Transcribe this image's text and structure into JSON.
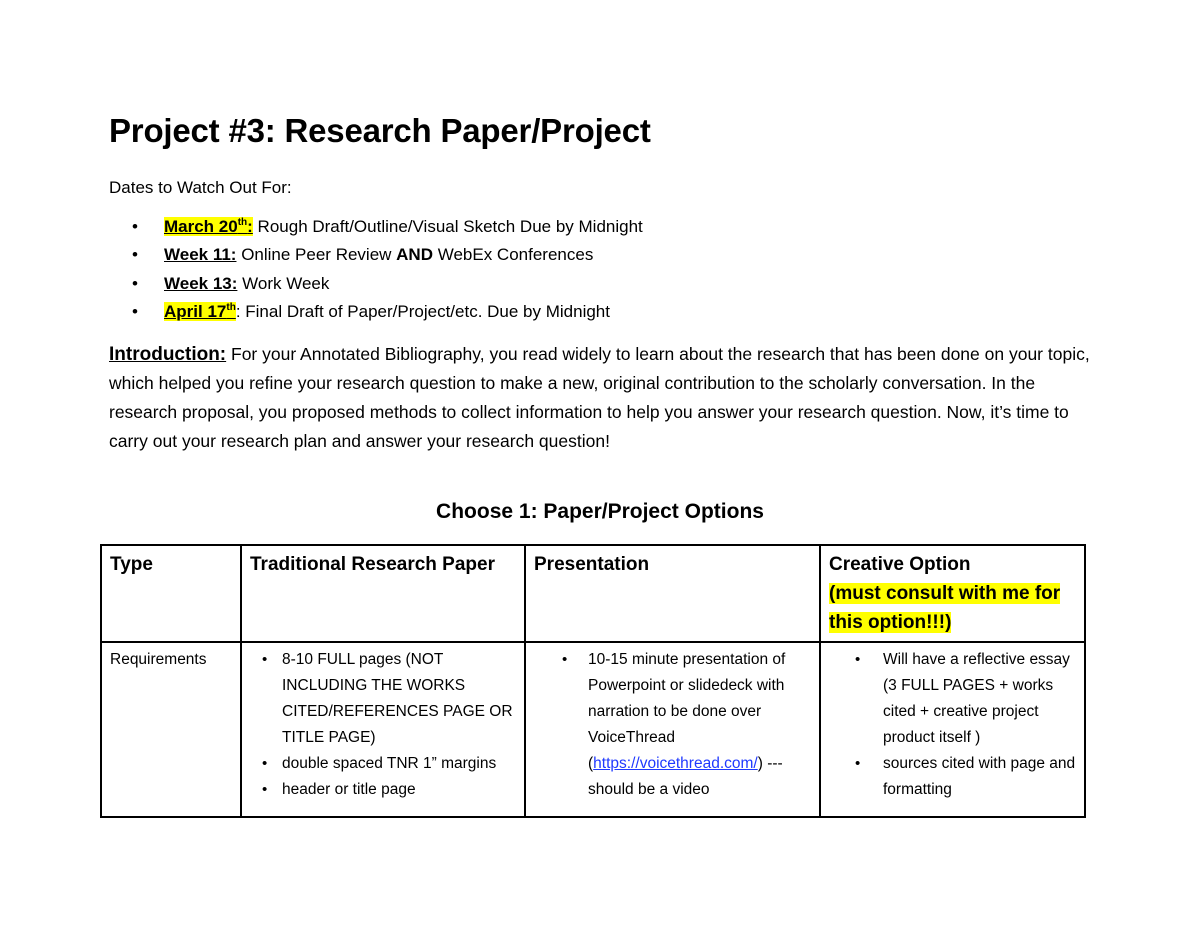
{
  "title": "Project #3: Research Paper/Project",
  "dates_label": "Dates to Watch Out For:",
  "dates": [
    {
      "label": "March 20",
      "sup": "th",
      "colon": ":",
      "text": " Rough Draft/Outline/Visual Sketch Due by Midnight"
    },
    {
      "label": "Week 11:",
      "text_a": " Online Peer Review ",
      "bold": "AND",
      "text_b": " WebEx Conferences"
    },
    {
      "label": "Week 13:",
      "text": " Work Week"
    },
    {
      "label": "April 17",
      "sup": "th",
      "text": ": Final Draft of Paper/Project/etc. Due by Midnight"
    }
  ],
  "intro": {
    "heading": "Introduction:",
    "body": " For your Annotated Bibliography, you read widely to learn about the research that has been done on your topic, which helped you refine your research question to make a new, original contribution to the scholarly conversation. In the research proposal, you proposed methods to collect information to help you answer your research question. Now, it’s time to carry out your research plan and answer your research question!"
  },
  "table": {
    "title": "Choose 1: Paper/Project Options",
    "headers": {
      "type": "Type",
      "traditional": "Traditional Research Paper",
      "presentation": "Presentation",
      "creative": "Creative Option",
      "creative_note": "(must consult with me for this option!!!)"
    },
    "row_label": "Requirements",
    "traditional_items": [
      "8-10 FULL pages (NOT INCLUDING THE WORKS CITED/REFERENCES PAGE OR TITLE PAGE)",
      "double spaced TNR 1” margins",
      "header or title page"
    ],
    "presentation": {
      "text_a": "10-15 minute presentation of Powerpoint or slidedeck with narration to be done over VoiceThread (",
      "link": "https://voicethread.com/",
      "text_b": ") ---should be a video"
    },
    "creative_items": [
      "Will have a reflective essay (3 FULL PAGES + works cited + creative project product itself )",
      " sources cited with page and formatting"
    ]
  },
  "colors": {
    "highlight": "#ffff00",
    "link": "#1f39ff"
  }
}
